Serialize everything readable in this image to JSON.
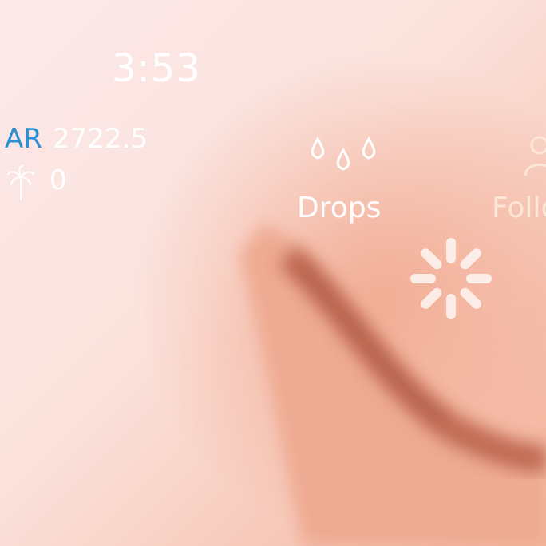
{
  "clock": {
    "time": "3:53"
  },
  "stats": {
    "ar_label": "AR",
    "ar_value": "2722.5",
    "palm_value": "0"
  },
  "actions": {
    "drops": {
      "label": "Drops",
      "icon": "drops-icon"
    },
    "follow": {
      "label": "Follo",
      "icon": "person-icon"
    }
  },
  "loading": {
    "icon": "spinner-icon"
  },
  "colors": {
    "accent": "#2f8fd3",
    "text": "#ffffff"
  }
}
